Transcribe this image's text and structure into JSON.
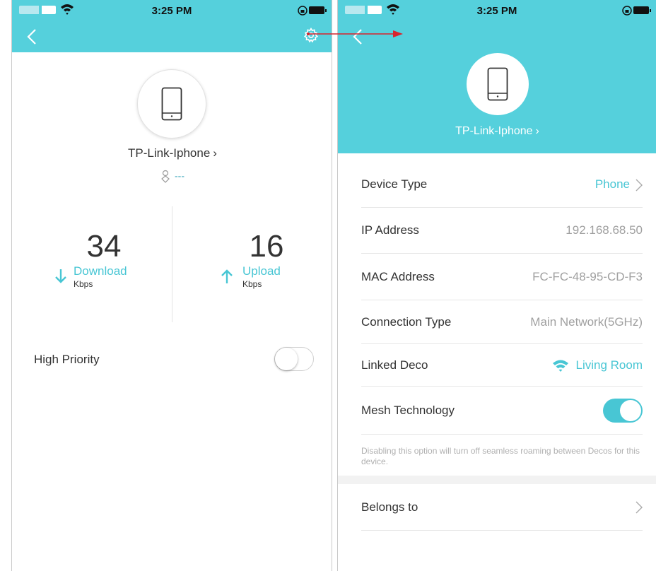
{
  "status_bar": {
    "time": "3:25 PM"
  },
  "left_screen": {
    "device_name": "TP-Link-Iphone",
    "owner": "---",
    "download": {
      "value": "34",
      "label": "Download",
      "unit": "Kbps"
    },
    "upload": {
      "value": "16",
      "label": "Upload",
      "unit": "Kbps"
    },
    "high_priority": {
      "label": "High Priority",
      "enabled": false
    }
  },
  "right_screen": {
    "device_name": "TP-Link-Iphone",
    "rows": [
      {
        "label": "Device Type",
        "value": "Phone"
      },
      {
        "label": "IP Address",
        "value": "192.168.68.50"
      },
      {
        "label": "MAC Address",
        "value": "FC-FC-48-95-CD-F3"
      },
      {
        "label": "Connection Type",
        "value": "Main Network(5GHz)"
      },
      {
        "label": "Linked Deco",
        "value": "Living Room"
      },
      {
        "label": "Mesh Technology",
        "enabled": true
      }
    ],
    "mesh_note": "Disabling this option will turn off seamless roaming between Decos for this device.",
    "belongs_to": {
      "label": "Belongs to"
    }
  },
  "colors": {
    "accent": "#55d0dc",
    "link": "#48c6d4",
    "annotation_arrow": "#d9232d"
  },
  "icons": [
    "signal-icon",
    "wifi-icon",
    "lock-icon",
    "battery-icon",
    "back-icon",
    "gear-icon",
    "phone-icon",
    "person-icon",
    "arrow-down-icon",
    "arrow-up-icon",
    "chevron-right-icon"
  ]
}
